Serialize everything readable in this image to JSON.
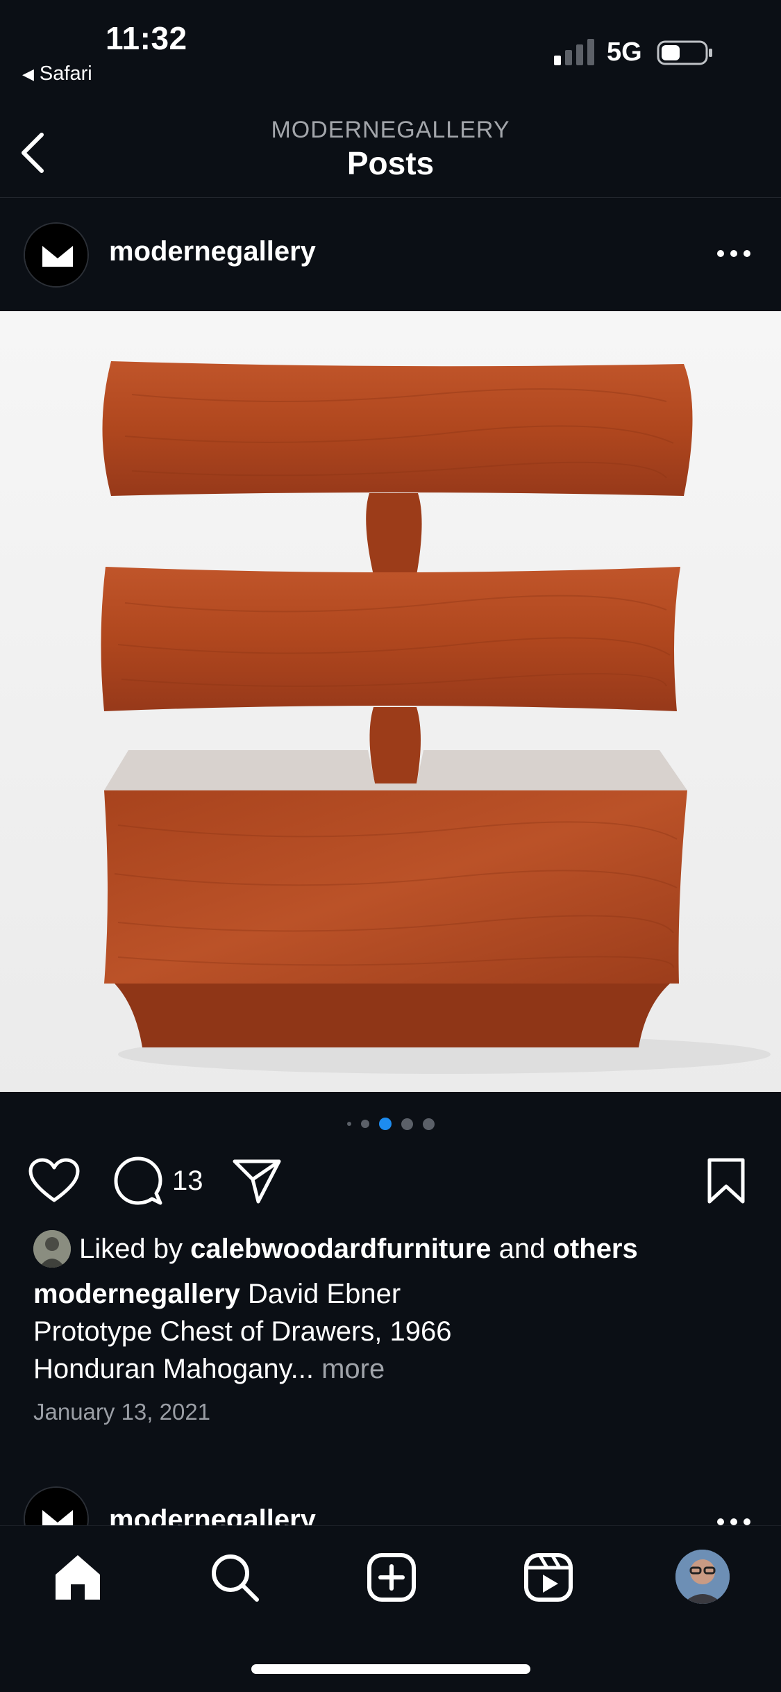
{
  "status_bar": {
    "time": "11:32",
    "back_app": "Safari",
    "network": "5G"
  },
  "header": {
    "supertitle": "MODERNEGALLERY",
    "title": "Posts"
  },
  "post": {
    "username": "modernegallery",
    "carousel": {
      "count": 5,
      "active_index": 2
    },
    "comment_count": "13",
    "likes": {
      "prefix": "Liked by",
      "user": "calebwoodardfurniture",
      "connector": "and",
      "others": "others"
    },
    "caption": {
      "username": "modernegallery",
      "line1": "David Ebner",
      "line2": "Prototype Chest of Drawers, 1966",
      "line3": "Honduran Mahogany...",
      "more": "more"
    },
    "date": "January 13, 2021"
  },
  "next_post": {
    "username": "modernegallery"
  },
  "tab_bar": {
    "items": [
      "home-icon",
      "search-icon",
      "create-icon",
      "reels-icon",
      "profile-avatar"
    ],
    "active": "home-icon"
  },
  "colors": {
    "background": "#0b0f15",
    "accent_dot": "#1d8cf0",
    "wood": "#b5491f"
  }
}
